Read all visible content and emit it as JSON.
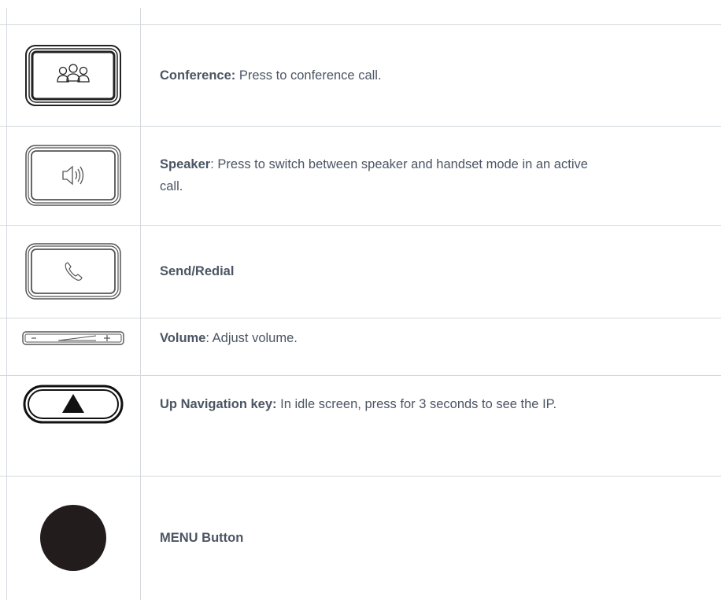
{
  "rows": [
    {
      "icon": "conference-icon",
      "term": "Conference:",
      "text": " Press to conference call."
    },
    {
      "icon": "speaker-icon",
      "term": "Speaker",
      "text": ": Press to switch between speaker and handset mode in an active call."
    },
    {
      "icon": "send-redial-icon",
      "term": "Send/Redial",
      "text": ""
    },
    {
      "icon": "volume-icon",
      "term": "Volume",
      "text": ": Adjust volume."
    },
    {
      "icon": "up-navigation-icon",
      "term": "Up Navigation key:",
      "text": " In idle screen, press for 3 seconds to see the IP."
    },
    {
      "icon": "menu-button-icon",
      "term": "MENU Button",
      "text": ""
    }
  ]
}
